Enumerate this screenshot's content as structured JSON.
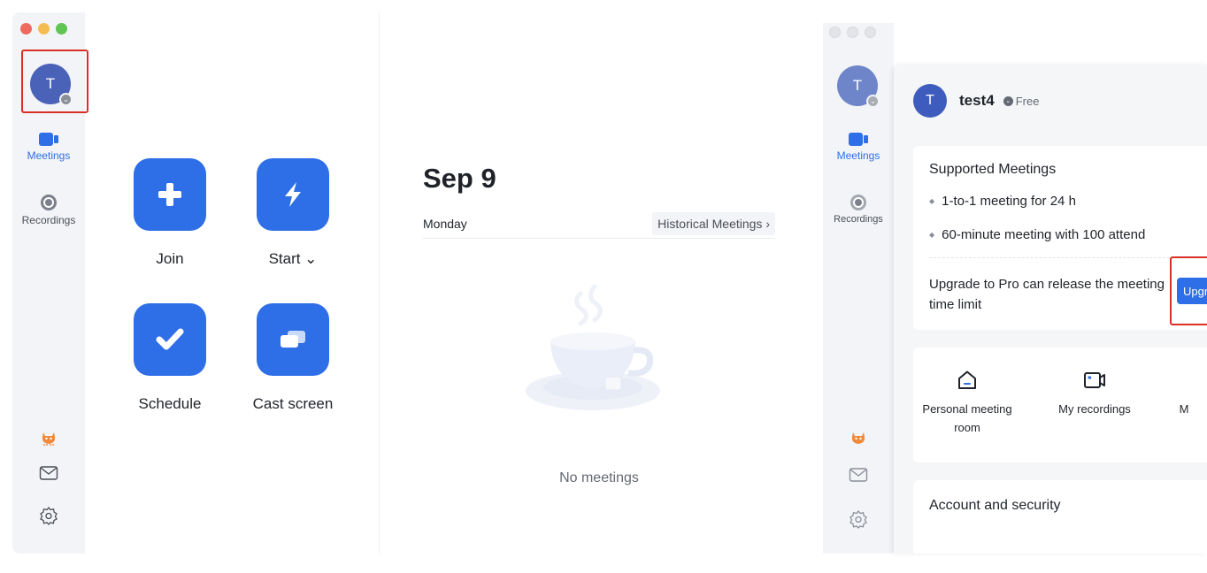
{
  "left_window": {
    "sidebar": {
      "avatar_initial": "T",
      "items": [
        {
          "label": "Meetings",
          "icon": "video-camera-icon",
          "active": true
        },
        {
          "label": "Recordings",
          "icon": "record-icon",
          "active": false
        }
      ],
      "bottom_icons": [
        "bug-mascot-icon",
        "mail-icon",
        "settings-gear-icon"
      ]
    },
    "actions": [
      {
        "label": "Join",
        "icon": "plus-icon"
      },
      {
        "label": "Start ⌄",
        "icon": "lightning-icon"
      },
      {
        "label": "Schedule",
        "icon": "check-icon"
      },
      {
        "label": "Cast screen",
        "icon": "cast-screen-icon"
      }
    ],
    "calendar": {
      "date": "Sep 9",
      "weekday": "Monday",
      "historical_label": "Historical Meetings ›",
      "empty_text": "No meetings"
    }
  },
  "right_window": {
    "sidebar": {
      "avatar_initial": "T",
      "items": [
        {
          "label": "Meetings",
          "icon": "video-camera-icon",
          "active": true
        },
        {
          "label": "Recordings",
          "icon": "record-icon",
          "active": false
        }
      ]
    },
    "profile": {
      "avatar_initial": "T",
      "name": "test4",
      "plan": "Free",
      "supported_title": "Supported Meetings",
      "features": [
        "1-to-1 meeting for 24 h",
        "60-minute meeting with 100 attend"
      ],
      "upgrade_text": "Upgrade to Pro can release the meeting time limit",
      "upgrade_button": "Upgrade",
      "quick_actions": [
        {
          "label": "Personal meeting room",
          "icon": "home-icon"
        },
        {
          "label": "My recordings",
          "icon": "video-recorder-icon"
        },
        {
          "label": "M",
          "icon": ""
        }
      ],
      "account_title": "Account and security"
    }
  },
  "colors": {
    "accent": "#2e6ee6",
    "highlight_border": "#d93025",
    "sidebar_bg": "#f3f4f7"
  }
}
